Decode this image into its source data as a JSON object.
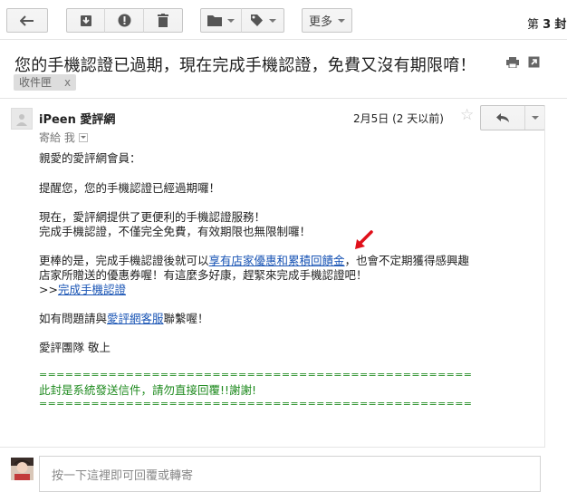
{
  "toolbar": {
    "back_icon": "back-arrow-icon",
    "archive_icon": "archive-icon",
    "spam_icon": "report-spam-icon",
    "delete_icon": "trash-icon",
    "move_icon": "folder-icon",
    "label_icon": "tag-icon",
    "more_label": "更多",
    "page_prefix": "第",
    "page_number": "3",
    "page_suffix": "封"
  },
  "email": {
    "subject": "您的手機認證已過期，現在完成手機認證，免費又沒有期限唷！",
    "label": "收件匣",
    "label_remove": "x",
    "print_icon": "print-icon",
    "newwindow_icon": "new-window-icon",
    "sender": "iPeen 愛評網",
    "to": "寄給 我",
    "date": "2月5日 (2 天以前)",
    "star_icon": "star-icon",
    "reply_icon": "reply-icon",
    "more_icon": "chevron-down-icon"
  },
  "body": {
    "greeting": "親愛的愛評網會員：",
    "p1": "提醒您，您的手機認證已經過期囉！",
    "p2_l1": "現在，愛評網提供了更便利的手機認證服務！",
    "p2_l2": "完成手機認證，不僅完全免費，有效期限也無限制囉！",
    "p3_l1_a": "更棒的是，完成手機認證後就可以",
    "p3_link1": "享有店家優惠和累積回饋金",
    "p3_l1_b": "，也會不定期獲得感興趣",
    "p3_l2": "店家所贈送的優惠券喔！有這麼多好康，趕緊來完成手機認證吧！",
    "p3_l3_prefix": ">>",
    "p3_link2": "完成手機認證",
    "p4_a": "如有問題請與",
    "p4_link": "愛評網客服",
    "p4_b": "聯繫喔！",
    "signature": "愛評團隊 敬上",
    "separator": "==================================================",
    "notice": "此封是系統發送信件，請勿直接回覆!!謝謝!"
  },
  "reply": {
    "placeholder": "按一下這裡即可回覆或轉寄"
  }
}
